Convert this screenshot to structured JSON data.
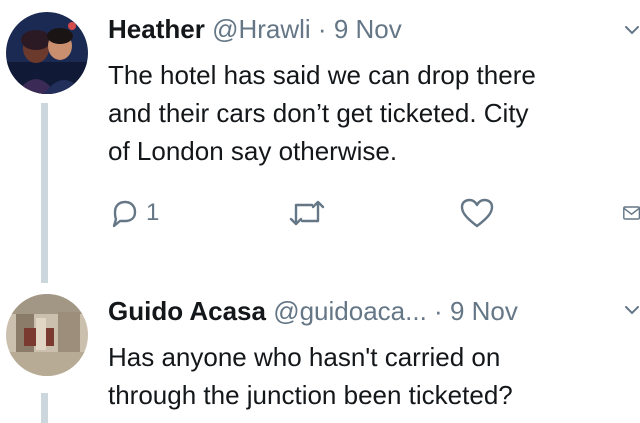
{
  "tweets": [
    {
      "name": "Heather",
      "handle": "@Hrawli",
      "separator": "·",
      "date": "9 Nov",
      "text": "The hotel has said we can drop there\nand their cars don’t get ticketed. City\nof London say otherwise.",
      "actions": {
        "reply_count": "1",
        "icons": [
          "reply-icon",
          "retweet-icon",
          "like-icon",
          "direct-message-icon"
        ]
      }
    },
    {
      "name": "Guido Acasa",
      "handle": "@guidoaca...",
      "separator": "·",
      "date": "9 Nov",
      "text": "Has anyone who hasn't carried on\nthrough the junction been ticketed?"
    }
  ],
  "colors": {
    "text": "#14171a",
    "secondary": "#657786",
    "thread_line": "#ccd6dd",
    "icon": "#657786"
  }
}
